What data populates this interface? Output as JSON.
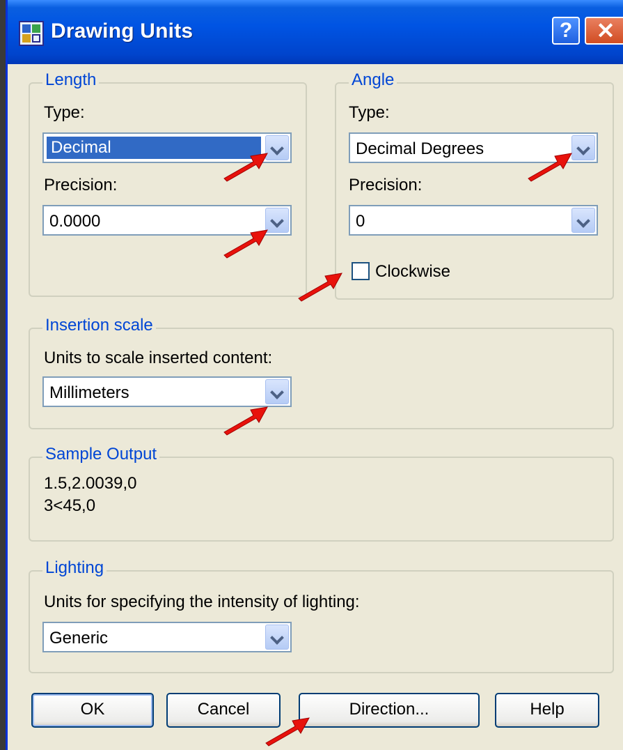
{
  "window": {
    "title": "Drawing Units"
  },
  "titlebar": {
    "help_glyph": "?",
    "close_glyph": "✕"
  },
  "length": {
    "legend": "Length",
    "type_label": "Type:",
    "type_value": "Decimal",
    "precision_label": "Precision:",
    "precision_value": "0.0000"
  },
  "angle": {
    "legend": "Angle",
    "type_label": "Type:",
    "type_value": "Decimal Degrees",
    "precision_label": "Precision:",
    "precision_value": "0",
    "clockwise_label": "Clockwise",
    "clockwise_checked": false
  },
  "insertion_scale": {
    "legend": "Insertion scale",
    "label": "Units to scale inserted content:",
    "value": "Millimeters"
  },
  "sample_output": {
    "legend": "Sample Output",
    "line1": "1.5,2.0039,0",
    "line2": "3<45,0"
  },
  "lighting": {
    "legend": "Lighting",
    "label": "Units for specifying the intensity of lighting:",
    "value": "Generic"
  },
  "buttons": {
    "ok": "OK",
    "cancel": "Cancel",
    "direction": "Direction...",
    "help": "Help"
  },
  "colors": {
    "titlebar": "#0054e3",
    "legend": "#0046d5",
    "dialog_bg": "#ece9d8",
    "annotation_arrow": "#e8120c"
  }
}
